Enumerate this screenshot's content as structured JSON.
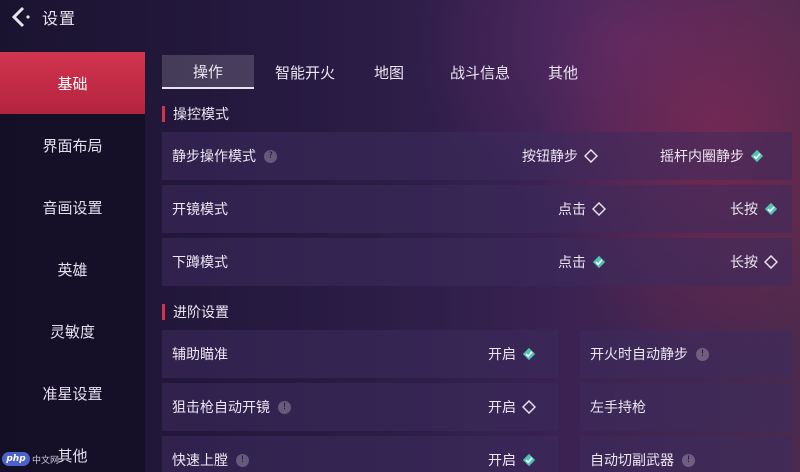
{
  "header": {
    "title": "设置"
  },
  "sidebar": {
    "items": [
      {
        "label": "基础"
      },
      {
        "label": "界面布局"
      },
      {
        "label": "音画设置"
      },
      {
        "label": "英雄"
      },
      {
        "label": "灵敏度"
      },
      {
        "label": "准星设置"
      },
      {
        "label": "其他"
      }
    ]
  },
  "tabs": [
    {
      "label": "操作"
    },
    {
      "label": "智能开火"
    },
    {
      "label": "地图"
    },
    {
      "label": "战斗信息"
    },
    {
      "label": "其他"
    }
  ],
  "sections": {
    "control_mode": {
      "title": "操控模式",
      "rows": [
        {
          "label": "静步操作模式",
          "has_info": true,
          "opt1": "按钮静步",
          "opt1_checked": false,
          "opt2": "摇杆内圈静步",
          "opt2_checked": true
        },
        {
          "label": "开镜模式",
          "has_info": false,
          "opt1": "点击",
          "opt1_checked": false,
          "opt2": "长按",
          "opt2_checked": true
        },
        {
          "label": "下蹲模式",
          "has_info": false,
          "opt1": "点击",
          "opt1_checked": true,
          "opt2": "长按",
          "opt2_checked": false
        }
      ]
    },
    "advanced": {
      "title": "进阶设置",
      "left": [
        {
          "label": "辅助瞄准",
          "has_info": false,
          "toggle": "开启",
          "checked": true
        },
        {
          "label": "狙击枪自动开镜",
          "has_info": true,
          "toggle": "开启",
          "checked": false
        },
        {
          "label": "快速上膛",
          "has_info": true,
          "toggle": "开启",
          "checked": true
        }
      ],
      "right": [
        {
          "label": "开火时自动静步",
          "has_info": true
        },
        {
          "label": "左手持枪",
          "has_info": false
        },
        {
          "label": "自动切副武器",
          "has_info": true
        }
      ]
    }
  },
  "watermark": {
    "logo": "php",
    "text": "中文网"
  },
  "colors": {
    "accent": "#d2344e",
    "check": "#4fc4b4"
  },
  "icons": {
    "back": "chevron-left-icon",
    "info": "info-icon",
    "checked": "checked-diamond-icon",
    "unchecked": "diamond-outline-icon"
  }
}
